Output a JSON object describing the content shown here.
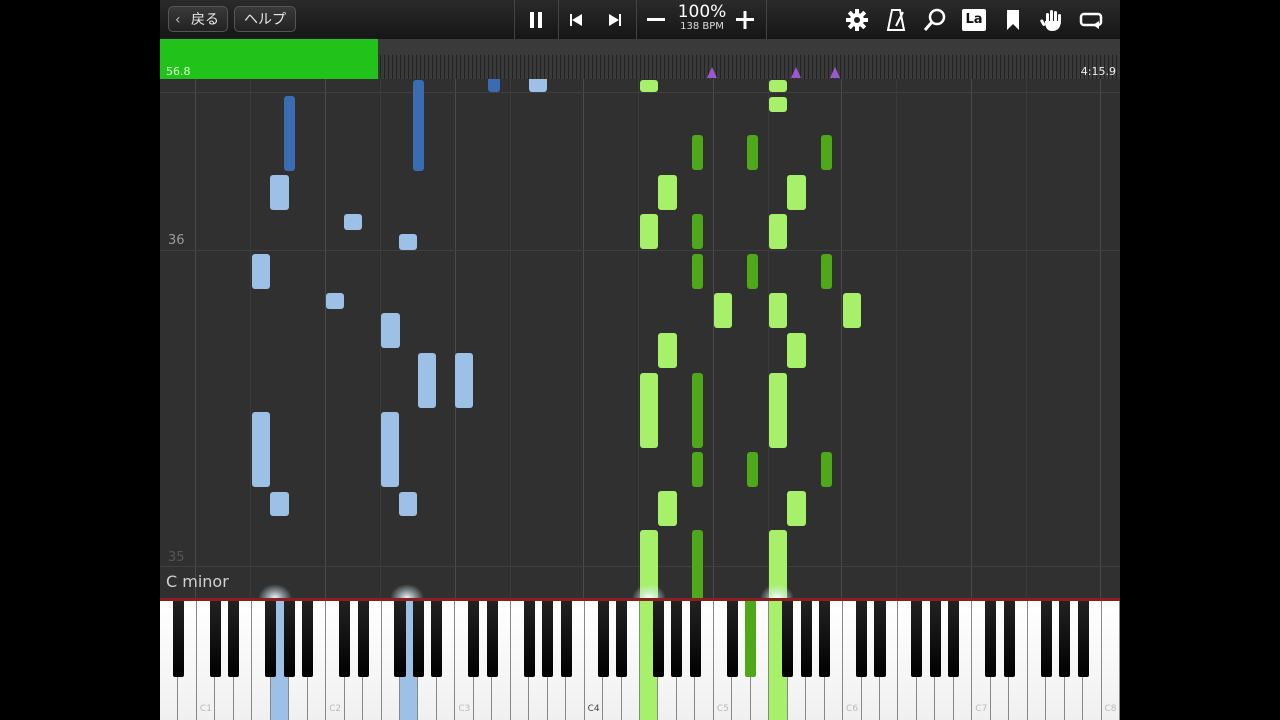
{
  "toolbar": {
    "back_label": "戻る",
    "help_label": "ヘルプ",
    "tempo_percent": "100%",
    "tempo_bpm": "138 BPM",
    "icons": [
      "pause-icon",
      "skip-back-icon",
      "skip-forward-icon",
      "minus-icon",
      "plus-icon",
      "gear-icon",
      "metronome-icon",
      "search-icon",
      "la-note-name-icon",
      "bookmark-icon",
      "hand-icon",
      "loop-icon"
    ],
    "la_label": "La"
  },
  "timeline": {
    "current_time": "56.8",
    "total_time": "4:15.9",
    "progress_fraction": 0.227,
    "marker_fractions": [
      0.575,
      0.662,
      0.703
    ]
  },
  "roll": {
    "bar_numbers": [
      "36",
      "35"
    ],
    "key_signature": "C minor"
  },
  "keyboard": {
    "octave_labels": [
      "C1",
      "C2",
      "C3",
      "C4",
      "C5",
      "C6",
      "C7",
      "C8"
    ]
  },
  "colors": {
    "left_hand_light": "#9cc0e6",
    "left_hand_dark": "#3a6cb2",
    "right_hand_light": "#a6f06a",
    "right_hand_dark": "#4ea81a",
    "progress": "#21c21a",
    "marker": "#9b59d0"
  }
}
